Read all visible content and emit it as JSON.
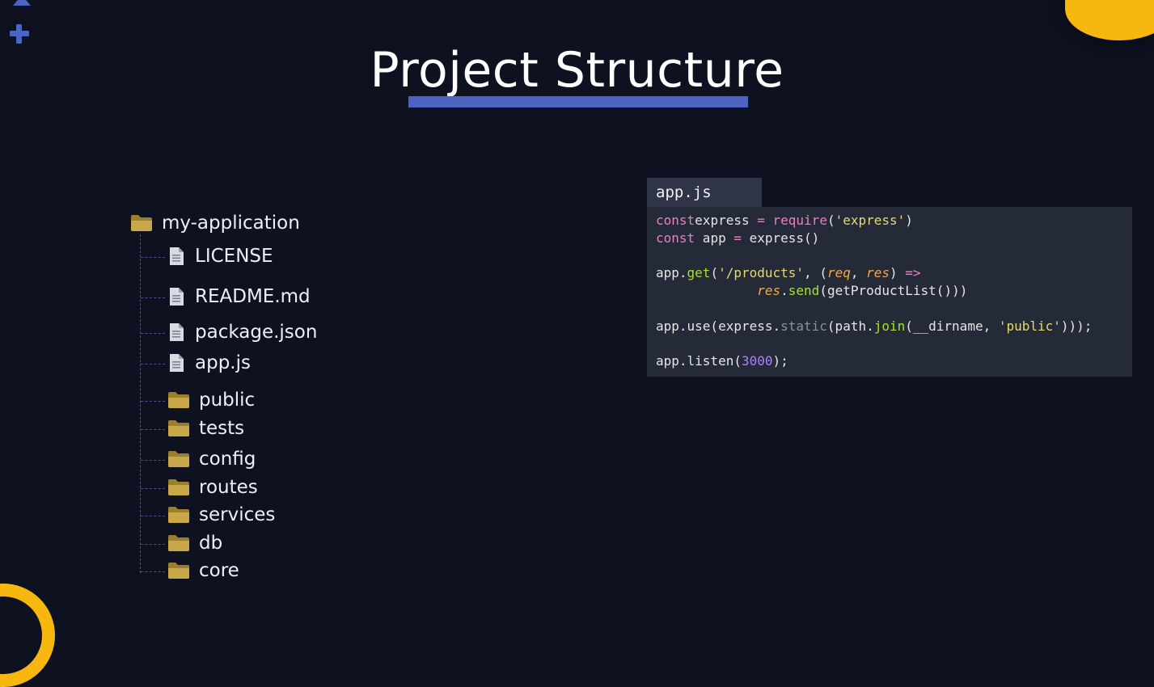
{
  "slide": {
    "title": "Project Structure",
    "accent_color": "#4c63c2",
    "decor_color": "#f6b70f"
  },
  "tree": {
    "root": {
      "name": "my-application",
      "icon": "folder-icon"
    },
    "items": [
      {
        "name": "LICENSE",
        "icon": "file-icon"
      },
      {
        "name": "README.md",
        "icon": "file-icon"
      },
      {
        "name": "package.json",
        "icon": "file-icon"
      },
      {
        "name": "app.js",
        "icon": "file-icon"
      },
      {
        "name": "public",
        "icon": "folder-icon"
      },
      {
        "name": "tests",
        "icon": "folder-icon"
      },
      {
        "name": "config",
        "icon": "folder-icon"
      },
      {
        "name": "routes",
        "icon": "folder-icon"
      },
      {
        "name": "services",
        "icon": "folder-icon"
      },
      {
        "name": "db",
        "icon": "folder-icon"
      },
      {
        "name": "core",
        "icon": "folder-icon"
      }
    ]
  },
  "code": {
    "filename": "app.js",
    "lines": [
      [
        [
          "kw",
          "const"
        ],
        [
          "",
          "express"
        ],
        [
          "kw",
          " = "
        ],
        [
          "kw",
          "require"
        ],
        [
          "",
          "("
        ],
        [
          "str",
          "'express'"
        ],
        [
          "",
          ")"
        ]
      ],
      [
        [
          "kw",
          "const"
        ],
        [
          "",
          "",
          " app"
        ],
        [
          "kw",
          " = "
        ],
        [
          "",
          "express()"
        ]
      ],
      [],
      [
        [
          "",
          "app."
        ],
        [
          "fn",
          "get"
        ],
        [
          "",
          "("
        ],
        [
          "str",
          "'/products'"
        ],
        [
          "",
          ", ("
        ],
        [
          "param",
          "req"
        ],
        [
          "",
          ", "
        ],
        [
          "param",
          "res"
        ],
        [
          "",
          ") "
        ],
        [
          "kw",
          "=>"
        ]
      ],
      [
        [
          "",
          "             "
        ],
        [
          "param",
          "res"
        ],
        [
          "",
          "."
        ],
        [
          "fn",
          "send"
        ],
        [
          "",
          "(getProductList()))"
        ]
      ],
      [],
      [
        [
          "",
          "app.use(express."
        ],
        [
          "dim",
          "static"
        ],
        [
          "",
          "(path."
        ],
        [
          "fn",
          "join"
        ],
        [
          "",
          "(__dirname, "
        ],
        [
          "str",
          "'public'"
        ],
        [
          "",
          ")));"
        ]
      ],
      [],
      [
        [
          "",
          "app.listen("
        ],
        [
          "num",
          "3000"
        ],
        [
          "",
          ");"
        ]
      ]
    ]
  }
}
